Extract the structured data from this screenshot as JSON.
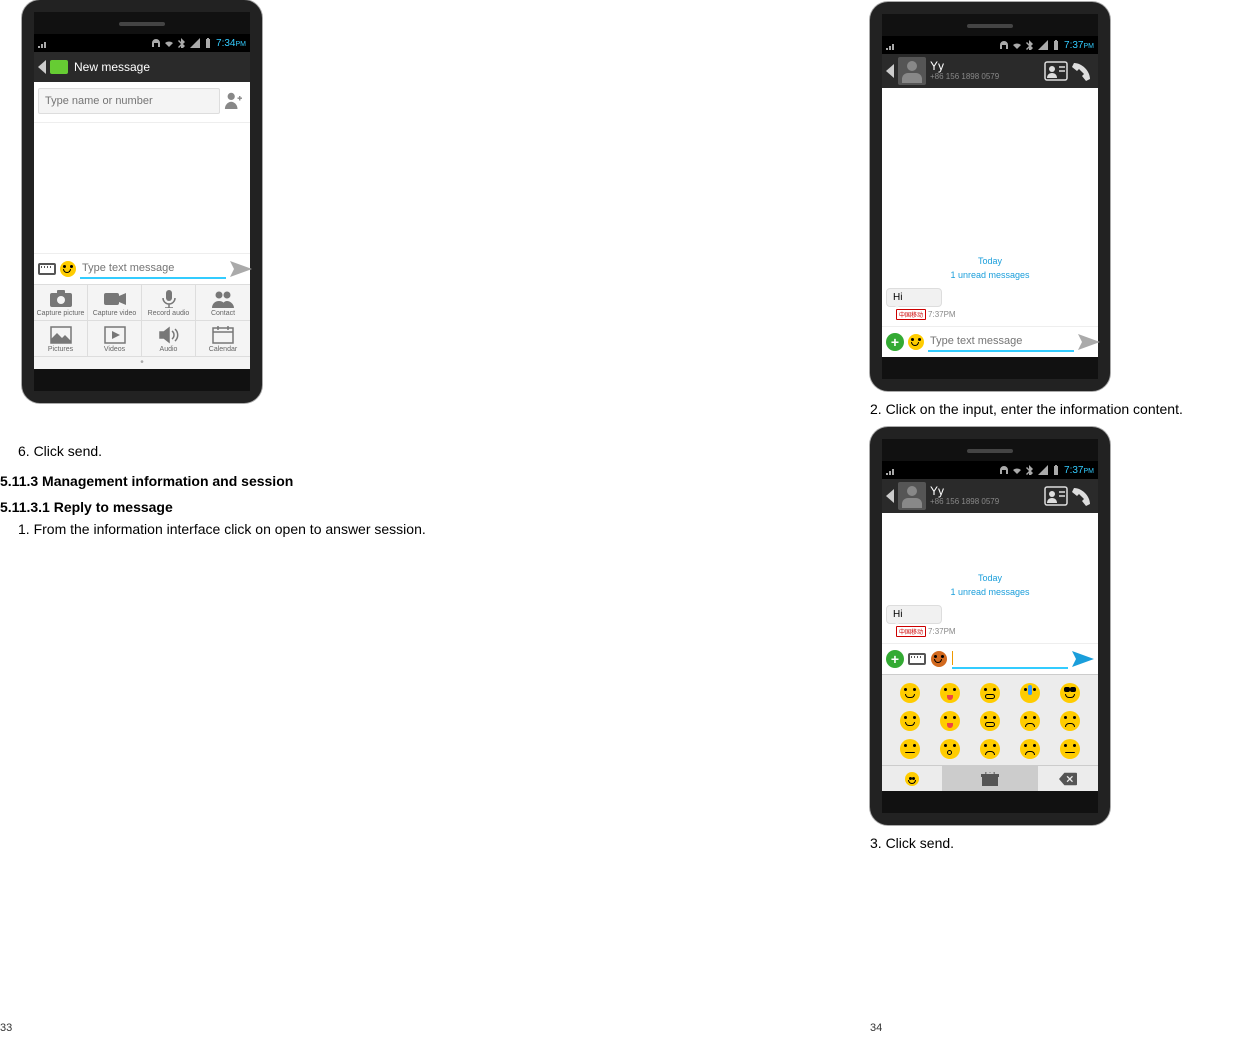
{
  "left": {
    "page_number": "33",
    "step6": "6. Click send.",
    "h3": "5.11.3  Management information and session",
    "h4": "5.11.3.1  Reply to message",
    "step1": "1. From the information interface click on open to answer session.",
    "phone1": {
      "status_time": "7:34",
      "status_ampm": "PM",
      "header_title": "New message",
      "recipient_placeholder": "Type name or number",
      "compose_placeholder": "Type text message",
      "attachments": [
        "Capture picture",
        "Capture video",
        "Record audio",
        "Contact",
        "Pictures",
        "Videos",
        "Audio",
        "Calendar"
      ]
    }
  },
  "right": {
    "page_number": "34",
    "step2": "2. Click on the input, enter the information content.",
    "step3": "3. Click send.",
    "phone2": {
      "status_time": "7:37",
      "status_ampm": "PM",
      "contact_name": "Yy",
      "contact_sub": "+86 156 1898 0579",
      "today": "Today",
      "unread": "1 unread messages",
      "msg_text": "Hi",
      "msg_carrier": "中国移动",
      "msg_time": "7:37PM",
      "compose_placeholder": "Type text message"
    },
    "phone3": {
      "status_time": "7:37",
      "status_ampm": "PM",
      "contact_name": "Yy",
      "contact_sub": "+86 156 1898 0579",
      "today": "Today",
      "unread": "1 unread messages",
      "msg_text": "Hi",
      "msg_carrier": "中国移动",
      "msg_time": "7:37PM"
    }
  }
}
